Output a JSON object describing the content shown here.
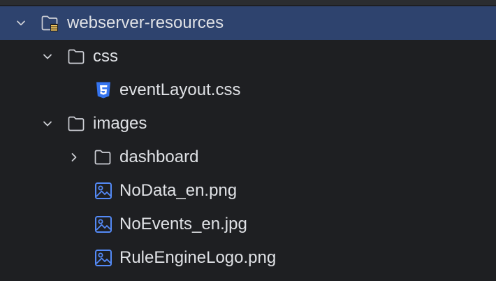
{
  "tree": {
    "root": {
      "label": "webserver-resources",
      "expanded": true,
      "selected": true,
      "icon": "module-folder-icon"
    },
    "css_folder": {
      "label": "css",
      "expanded": true,
      "icon": "folder-icon"
    },
    "css_file": {
      "label": "eventLayout.css",
      "icon": "css-file-icon"
    },
    "images_folder": {
      "label": "images",
      "expanded": true,
      "icon": "folder-icon"
    },
    "dashboard_folder": {
      "label": "dashboard",
      "expanded": false,
      "icon": "folder-icon"
    },
    "files": [
      {
        "label": "NoData_en.png",
        "icon": "image-file-icon"
      },
      {
        "label": "NoEvents_en.jpg",
        "icon": "image-file-icon"
      },
      {
        "label": "RuleEngineLogo.png",
        "icon": "image-file-icon"
      }
    ]
  },
  "colors": {
    "background": "#1e1f22",
    "selection": "#2e436e",
    "text": "#dfe1e5",
    "css_badge": "#3574f0",
    "image_icon": "#548af7"
  }
}
